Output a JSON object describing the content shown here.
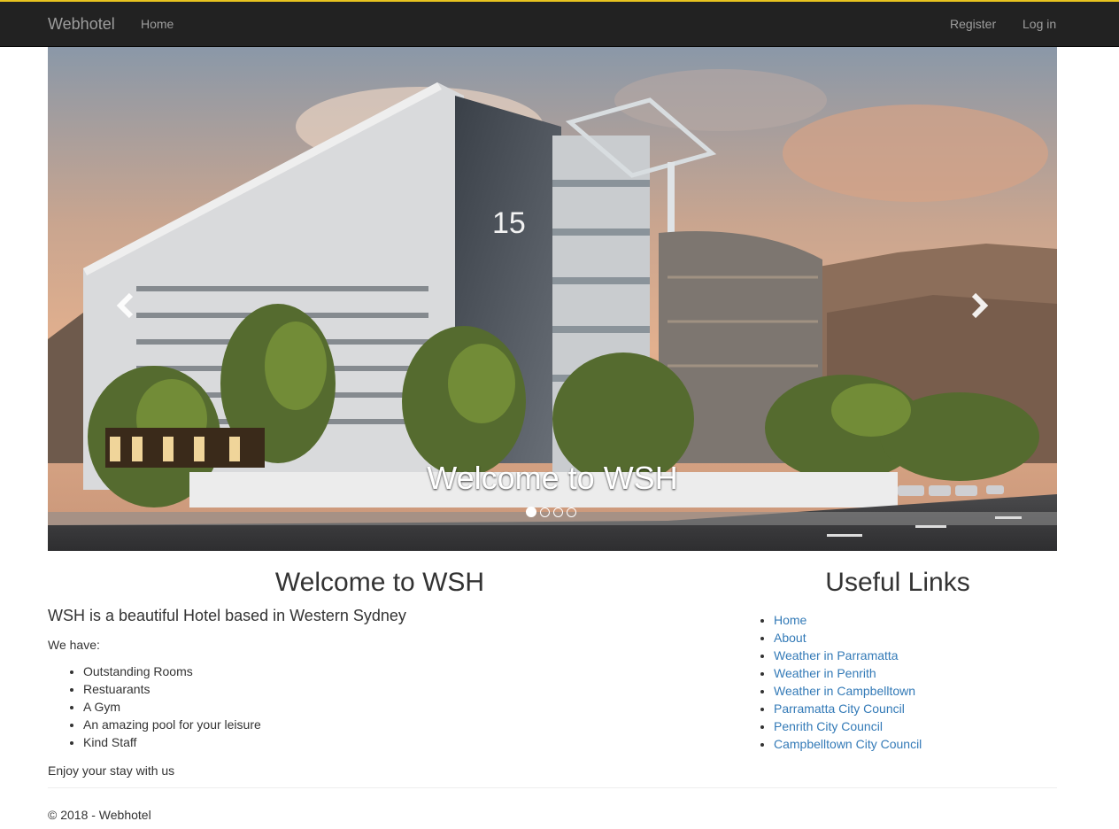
{
  "navbar": {
    "brand": "Webhotel",
    "home": "Home",
    "register": "Register",
    "login": "Log in"
  },
  "carousel": {
    "caption": "Welcome to WSH",
    "slides": 4,
    "active_slide": 1,
    "prev_icon": "chevron-left-icon",
    "next_icon": "chevron-right-icon"
  },
  "main": {
    "title": "Welcome to WSH",
    "lead": "WSH is a beautiful Hotel based in Western Sydney",
    "have": "We have:",
    "amenities": [
      "Outstanding Rooms",
      "Restuarants",
      "A Gym",
      "An amazing pool for your leisure",
      "Kind Staff"
    ],
    "enjoy": "Enjoy your stay with us"
  },
  "useful_links": {
    "title": "Useful Links",
    "items": [
      "Home",
      "About",
      "Weather in Parramatta",
      "Weather in Penrith",
      "Weather in Campbelltown",
      "Parramatta City Council",
      "Penrith City Council",
      "Campbelltown City Council"
    ]
  },
  "footer": {
    "text": "© 2018 - Webhotel"
  },
  "colors": {
    "navbar_bg": "#222222",
    "nav_text": "#9d9d9d",
    "link": "#337ab7",
    "accent_line": "#e7c31f"
  }
}
